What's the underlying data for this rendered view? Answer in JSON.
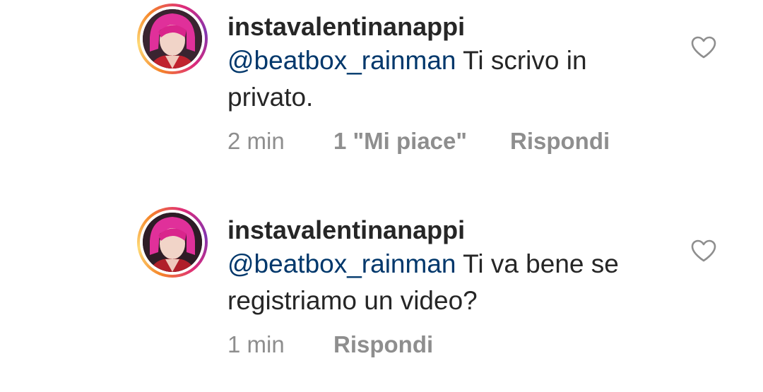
{
  "comments": [
    {
      "username": "instavalentinanappi",
      "mention": "@beatbox_rainman",
      "text": " Ti scrivo in privato.",
      "time": "2 min",
      "likes": "1 \"Mi piace\"",
      "reply": "Rispondi"
    },
    {
      "username": "instavalentinanappi",
      "mention": "@beatbox_rainman",
      "text": " Ti va bene se registriamo un video?",
      "time": "1 min",
      "reply": "Rispondi"
    }
  ],
  "icons": {
    "like": "heart-outline-icon",
    "avatar": "profile-avatar"
  },
  "colors": {
    "mention": "#00376b",
    "text": "#262626",
    "meta": "#8e8e8e"
  }
}
